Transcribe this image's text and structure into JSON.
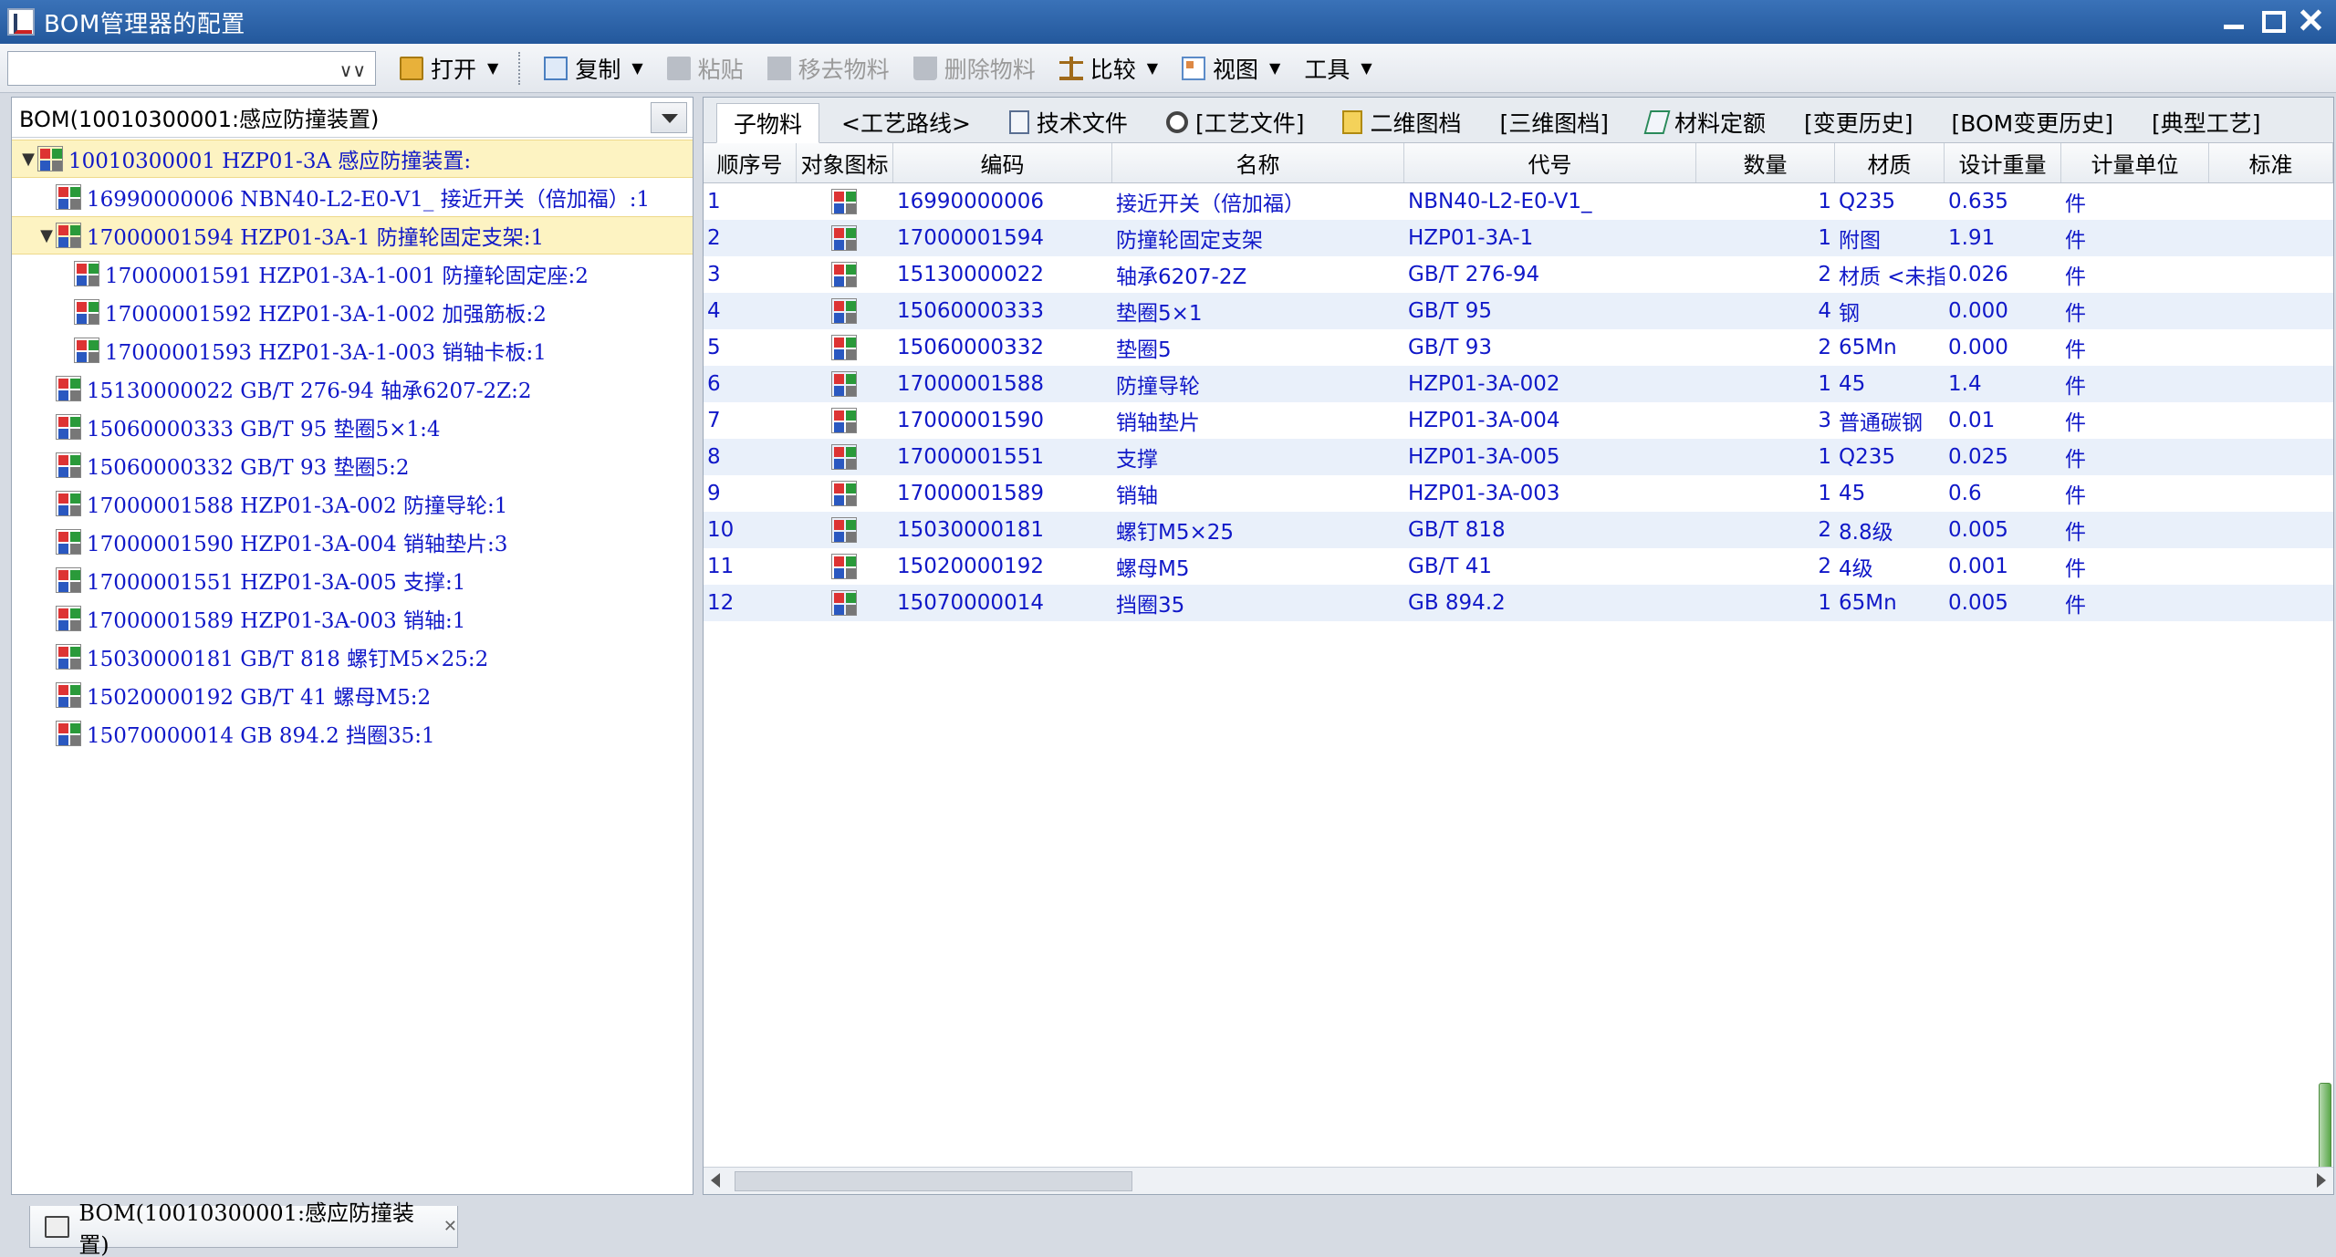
{
  "window": {
    "title": "BOM管理器的配置"
  },
  "toolbar": {
    "combo_value": "",
    "open": "打开",
    "copy": "复制",
    "paste": "粘贴",
    "remove_material": "移去物料",
    "delete_material": "删除物料",
    "compare": "比较",
    "view": "视图",
    "tools": "工具"
  },
  "left": {
    "combo_value": "BOM(10010300001:感应防撞装置)",
    "tree": [
      {
        "label": "10010300001 HZP01-3A 感应防撞装置:",
        "level": 0,
        "toggle": "▼",
        "selected": true
      },
      {
        "label": "16990000006 NBN40-L2-E0-V1_ 接近开关（倍加福）:1",
        "level": 1,
        "toggle": "",
        "selected": false
      },
      {
        "label": "17000001594 HZP01-3A-1 防撞轮固定支架:1",
        "level": 1,
        "toggle": "▼",
        "selected": true
      },
      {
        "label": "17000001591 HZP01-3A-1-001 防撞轮固定座:2",
        "level": 2,
        "toggle": "",
        "selected": false
      },
      {
        "label": "17000001592 HZP01-3A-1-002 加强筋板:2",
        "level": 2,
        "toggle": "",
        "selected": false
      },
      {
        "label": "17000001593 HZP01-3A-1-003 销轴卡板:1",
        "level": 2,
        "toggle": "",
        "selected": false
      },
      {
        "label": "15130000022 GB/T 276-94 轴承6207-2Z:2",
        "level": 1,
        "toggle": "",
        "selected": false
      },
      {
        "label": "15060000333 GB/T 95 垫圈5×1:4",
        "level": 1,
        "toggle": "",
        "selected": false
      },
      {
        "label": "15060000332 GB/T 93 垫圈5:2",
        "level": 1,
        "toggle": "",
        "selected": false
      },
      {
        "label": "17000001588 HZP01-3A-002 防撞导轮:1",
        "level": 1,
        "toggle": "",
        "selected": false
      },
      {
        "label": "17000001590 HZP01-3A-004 销轴垫片:3",
        "level": 1,
        "toggle": "",
        "selected": false
      },
      {
        "label": "17000001551 HZP01-3A-005 支撑:1",
        "level": 1,
        "toggle": "",
        "selected": false
      },
      {
        "label": "17000001589 HZP01-3A-003 销轴:1",
        "level": 1,
        "toggle": "",
        "selected": false
      },
      {
        "label": "15030000181 GB/T 818 螺钉M5×25:2",
        "level": 1,
        "toggle": "",
        "selected": false
      },
      {
        "label": "15020000192 GB/T 41 螺母M5:2",
        "level": 1,
        "toggle": "",
        "selected": false
      },
      {
        "label": "15070000014 GB 894.2 挡圈35:1",
        "level": 1,
        "toggle": "",
        "selected": false
      }
    ]
  },
  "tabs": [
    {
      "label": "子物料",
      "active": true,
      "icon": ""
    },
    {
      "label": "<工艺路线>",
      "active": false,
      "icon": ""
    },
    {
      "label": "技术文件",
      "active": false,
      "icon": "doc-icon"
    },
    {
      "label": "[工艺文件]",
      "active": false,
      "icon": "gear-icon"
    },
    {
      "label": "二维图档",
      "active": false,
      "icon": "drawing-icon"
    },
    {
      "label": "[三维图档]",
      "active": false,
      "icon": ""
    },
    {
      "label": "材料定额",
      "active": false,
      "icon": "material-icon"
    },
    {
      "label": "[变更历史]",
      "active": false,
      "icon": ""
    },
    {
      "label": "[BOM变更历史]",
      "active": false,
      "icon": ""
    },
    {
      "label": "[典型工艺]",
      "active": false,
      "icon": ""
    }
  ],
  "grid": {
    "headers": [
      "顺序号",
      "对象图标",
      "编码",
      "名称",
      "代号",
      "数量",
      "材质",
      "设计重量",
      "计量单位",
      "标准"
    ],
    "rows": [
      [
        "1",
        "16990000006",
        "接近开关（倍加福）",
        "NBN40-L2-E0-V1_",
        "1",
        "Q235",
        "0.635",
        "件"
      ],
      [
        "2",
        "17000001594",
        "防撞轮固定支架",
        "HZP01-3A-1",
        "1",
        "附图",
        "1.91",
        "件"
      ],
      [
        "3",
        "15130000022",
        "轴承6207-2Z",
        "GB/T 276-94",
        "2",
        "材质 <未指定>",
        "0.026",
        "件"
      ],
      [
        "4",
        "15060000333",
        "垫圈5×1",
        "GB/T 95",
        "4",
        "钢",
        "0.000",
        "件"
      ],
      [
        "5",
        "15060000332",
        "垫圈5",
        "GB/T 93",
        "2",
        "65Mn",
        "0.000",
        "件"
      ],
      [
        "6",
        "17000001588",
        "防撞导轮",
        "HZP01-3A-002",
        "1",
        "45",
        "1.4",
        "件"
      ],
      [
        "7",
        "17000001590",
        "销轴垫片",
        "HZP01-3A-004",
        "3",
        "普通碳钢",
        "0.01",
        "件"
      ],
      [
        "8",
        "17000001551",
        "支撑",
        "HZP01-3A-005",
        "1",
        "Q235",
        "0.025",
        "件"
      ],
      [
        "9",
        "17000001589",
        "销轴",
        "HZP01-3A-003",
        "1",
        "45",
        "0.6",
        "件"
      ],
      [
        "10",
        "15030000181",
        "螺钉M5×25",
        "GB/T 818",
        "2",
        "8.8级",
        "0.005",
        "件"
      ],
      [
        "11",
        "15020000192",
        "螺母M5",
        "GB/T 41",
        "2",
        "4级",
        "0.001",
        "件"
      ],
      [
        "12",
        "15070000014",
        "挡圈35",
        "GB 894.2",
        "1",
        "65Mn",
        "0.005",
        "件"
      ]
    ]
  },
  "bottom": {
    "doc_tab": "BOM(10010300001:感应防撞装置)"
  }
}
